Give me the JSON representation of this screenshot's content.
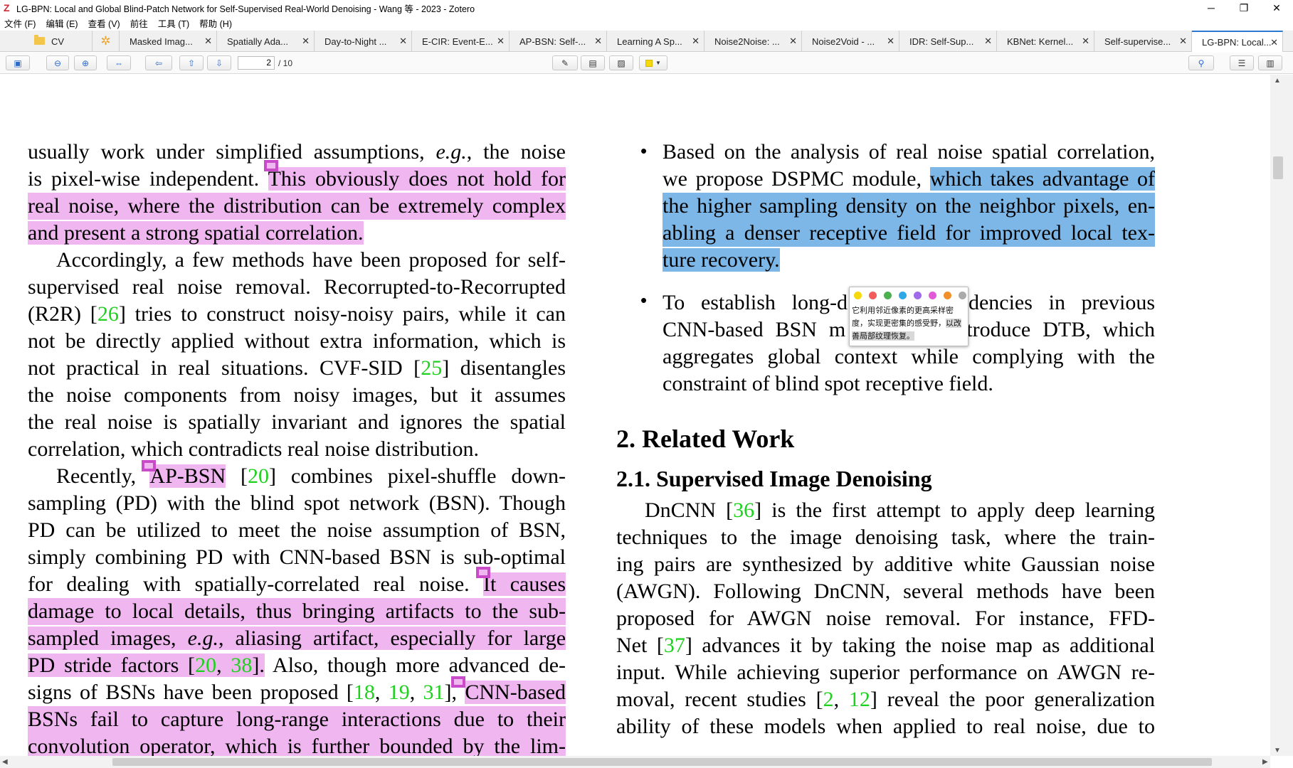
{
  "window": {
    "title": "LG-BPN: Local and Global Blind-Patch Network for Self-Supervised Real-World Denoising - Wang 等 - 2023 - Zotero",
    "minimize": "─",
    "maximize": "❐",
    "close": "✕"
  },
  "menu": [
    "文件 (F)",
    "编辑 (E)",
    "查看 (V)",
    "前往",
    "工具 (T)",
    "帮助 (H)"
  ],
  "tabs": [
    {
      "label": "Masked Imag...",
      "close": "✕"
    },
    {
      "label": "Spatially Ada...",
      "close": "✕"
    },
    {
      "label": "Day-to-Night ...",
      "close": "✕"
    },
    {
      "label": "E-CIR: Event-E...",
      "close": "✕"
    },
    {
      "label": "AP-BSN: Self-...",
      "close": "✕"
    },
    {
      "label": "Learning A Sp...",
      "close": "✕"
    },
    {
      "label": "Noise2Noise: ...",
      "close": "✕"
    },
    {
      "label": "Noise2Void - ...",
      "close": "✕"
    },
    {
      "label": "IDR: Self-Sup...",
      "close": "✕"
    },
    {
      "label": "KBNet: Kernel...",
      "close": "✕"
    },
    {
      "label": "Self-supervise...",
      "close": "✕"
    },
    {
      "label": "LG-BPN: Local...",
      "close": "✕",
      "active": true
    }
  ],
  "library_tab": {
    "label": "CV"
  },
  "toolbar": {
    "current_page": "2",
    "page_total": "/ 10",
    "highlight_color": "#f5d90a"
  },
  "doc": {
    "left": {
      "p1": [
        "usually work under simplified assumptions, ",
        "e.g.",
        ", the noise",
        "is pixel-wise independent. ",
        "This obviously does not hold for",
        "real noise, where the distribution can be extremely complex",
        "and present a strong spatial correlation."
      ],
      "p2": [
        "Accordingly, a few methods have been proposed for self-",
        "supervised real noise removal. Recorrupted-to-Recorrupted",
        "(R2R) [",
        "26",
        "] tries to construct noisy-noisy pairs, while it can",
        "not be directly applied without extra information, which is",
        "not practical in real situations. CVF-SID [",
        "25",
        "] disentangles",
        "the noise components from noisy images, but it assumes",
        "the real noise is spatially invariant and ignores the spatial",
        "correlation, which contradicts real noise distribution."
      ],
      "p3": [
        "Recently, ",
        "AP-BSN",
        " [",
        "20",
        "] combines pixel-shuffle down-",
        "sampling (PD) with the blind spot network (BSN). Though",
        "PD can be utilized to meet the noise assumption of BSN,",
        "simply combining PD with CNN-based BSN is sub-optimal",
        "for dealing with spatially-correlated real noise. ",
        "It causes",
        "damage to local details, thus bringing artifacts to the sub-",
        "sampled images, ",
        "e.g.",
        ", aliasing artifact, especially for large",
        "PD stride factors [",
        "20",
        ", ",
        "38",
        "].",
        " Also, though more advanced de-",
        "signs of BSNs have been proposed [",
        "18",
        ", ",
        "19",
        ", ",
        "31",
        "], ",
        "CNN-based",
        "BSNs fail to capture long-range interactions due to their",
        "convolution operator, which is further bounded by the lim-"
      ]
    },
    "right": {
      "b1": [
        "Based on the analysis of real noise spatial correlation,",
        "we propose DSPMC module, ",
        "which takes advantage of",
        "the higher sampling density on the neighbor pixels, en-",
        "abling a denser receptive field for improved local tex-",
        "ture recovery."
      ],
      "b2": [
        "To establish long-d",
        "dencies in previous",
        "CNN-based BSN m",
        "troduce DTB, which",
        "aggregates global context while complying with the",
        "constraint of blind spot receptive field."
      ],
      "h1": "2. Related Work",
      "h2": "2.1. Supervised Image Denoising",
      "p1": [
        "DnCNN [",
        "36",
        "] is the first attempt to apply deep learning",
        "techniques to the image denoising task, where the train-",
        "ing pairs are synthesized by additive white Gaussian noise",
        "(AWGN). Following DnCNN, several methods have been",
        "proposed for AWGN noise removal.  For instance, FFD-",
        "Net [",
        "37",
        "] advances it by taking the noise map as additional",
        "input. While achieving superior performance on AWGN re-",
        "moval, recent studies [",
        "2",
        ", ",
        "12",
        "] reveal the poor generalization",
        "ability of these models when applied to real noise, due to"
      ]
    }
  },
  "popup": {
    "colors": [
      "#f5d90a",
      "#f25c5c",
      "#4caf50",
      "#2ea8e6",
      "#a06be8",
      "#e05ad8",
      "#f0902a",
      "#aaaaaa"
    ],
    "text1": "它利用邻近像素的更高采样密度，实现更密集的感受野，",
    "text_sel": "以改善局部纹理恢复。"
  }
}
